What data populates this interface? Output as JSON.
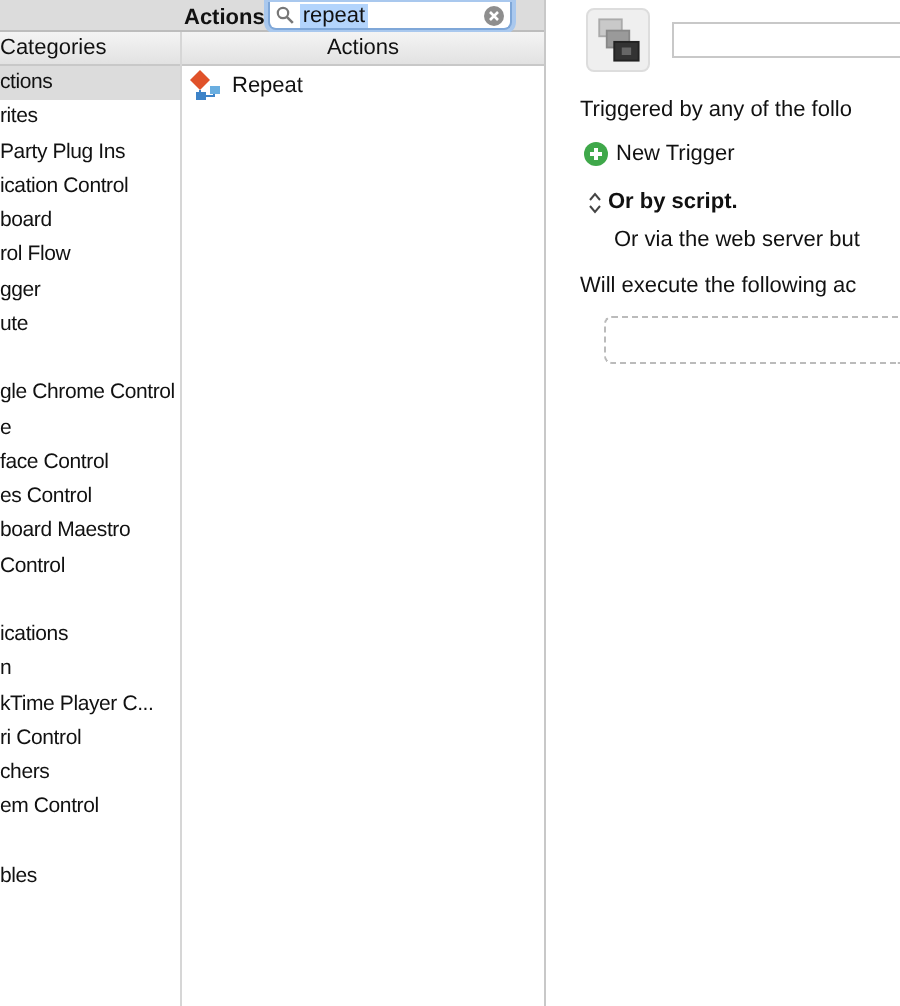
{
  "toolbar": {
    "label": "Actions",
    "search": {
      "value": "repeat",
      "selected": true
    }
  },
  "categories": {
    "heading": "Categories",
    "items": [
      {
        "kind": "text",
        "label": "ctions",
        "selected": true
      },
      {
        "kind": "text",
        "label": "rites",
        "selected": false
      },
      {
        "kind": "text",
        "label": "Party Plug Ins",
        "selected": false
      },
      {
        "kind": "text",
        "label": "ication Control",
        "selected": false
      },
      {
        "kind": "text",
        "label": "board",
        "selected": false
      },
      {
        "kind": "text",
        "label": "rol Flow",
        "selected": false
      },
      {
        "kind": "text",
        "label": "gger",
        "selected": false
      },
      {
        "kind": "text",
        "label": "ute",
        "selected": false
      },
      {
        "kind": "clipped",
        "selected": false
      },
      {
        "kind": "text",
        "label": "gle Chrome Control",
        "selected": false
      },
      {
        "kind": "text",
        "label": "e",
        "selected": false
      },
      {
        "kind": "text",
        "label": "face Control",
        "selected": false
      },
      {
        "kind": "text",
        "label": "es Control",
        "selected": false
      },
      {
        "kind": "text",
        "label": "board Maestro",
        "selected": false
      },
      {
        "kind": "text",
        "label": "Control",
        "selected": false
      },
      {
        "kind": "clipped",
        "selected": false
      },
      {
        "kind": "text",
        "label": "ications",
        "selected": false
      },
      {
        "kind": "text",
        "label": "n",
        "selected": false
      },
      {
        "kind": "text",
        "label": "kTime Player C...",
        "selected": false
      },
      {
        "kind": "text",
        "label": "ri Control",
        "selected": false
      },
      {
        "kind": "text",
        "label": "chers",
        "selected": false
      },
      {
        "kind": "text",
        "label": "em Control",
        "selected": false
      },
      {
        "kind": "clipped",
        "selected": false
      },
      {
        "kind": "text",
        "label": "bles",
        "selected": false
      }
    ]
  },
  "actions": {
    "heading": "Actions",
    "items": [
      {
        "label": "Repeat"
      }
    ]
  },
  "editor": {
    "trigger_intro": "Triggered by any of the follo",
    "new_trigger": "New Trigger",
    "script_toggle": "Or by script.",
    "web_server": "Or via the web server but",
    "execute_intro": "Will execute the following ac"
  }
}
